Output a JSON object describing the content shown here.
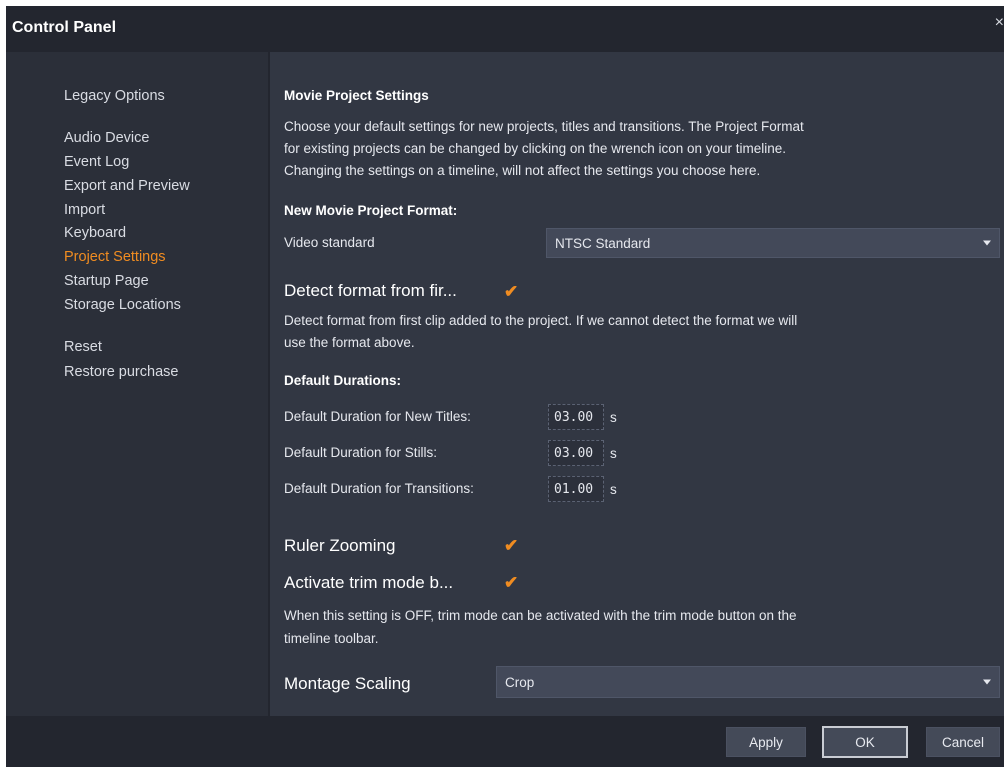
{
  "window": {
    "title": "Control Panel",
    "close_icon": "×"
  },
  "sidebar": {
    "items": [
      {
        "label": "Legacy Options",
        "active": false
      },
      {
        "label": "Audio Device",
        "active": false
      },
      {
        "label": "Event Log",
        "active": false
      },
      {
        "label": "Export and Preview",
        "active": false
      },
      {
        "label": "Import",
        "active": false
      },
      {
        "label": "Keyboard",
        "active": false
      },
      {
        "label": "Project Settings",
        "active": true
      },
      {
        "label": "Startup Page",
        "active": false
      },
      {
        "label": "Storage Locations",
        "active": false
      },
      {
        "label": "Reset",
        "active": false
      },
      {
        "label": "Restore purchase",
        "active": false
      }
    ]
  },
  "main": {
    "section_title": "Movie Project Settings",
    "intro_line1": "Choose your default settings for new projects, titles and transitions. The Project Format",
    "intro_line2": "for existing projects can be changed by clicking on the wrench icon on your timeline.",
    "intro_line3": "Changing the settings on a timeline, will not affect the settings you choose here.",
    "format_heading": "New Movie Project Format:",
    "video_standard_label": "Video standard",
    "video_standard_value": "NTSC Standard",
    "detect_label": "Detect format from fir...",
    "detect_checked": true,
    "detect_desc_line1": "Detect format from first clip added to the project. If we cannot detect the format we will",
    "detect_desc_line2": "use the format above.",
    "durations_heading": "Default Durations:",
    "durations": [
      {
        "label": "Default Duration for New Titles:",
        "value": "03.00",
        "unit": "s"
      },
      {
        "label": "Default Duration for Stills:",
        "value": "03.00",
        "unit": "s"
      },
      {
        "label": "Default Duration for Transitions:",
        "value": "01.00",
        "unit": "s"
      }
    ],
    "ruler_zooming_label": "Ruler Zooming",
    "ruler_zooming_checked": true,
    "trim_mode_label": "Activate trim mode b...",
    "trim_mode_checked": true,
    "trim_desc_line1": "When this setting is OFF, trim mode can be activated with the trim mode button on the",
    "trim_desc_line2": "timeline toolbar.",
    "montage_label": "Montage Scaling",
    "montage_value": "Crop",
    "check_glyph": "✔"
  },
  "footer": {
    "apply_label": "Apply",
    "ok_label": "OK",
    "cancel_label": "Cancel"
  },
  "colors": {
    "accent": "#f08c21",
    "background": "#23262f",
    "content": "#323743"
  }
}
